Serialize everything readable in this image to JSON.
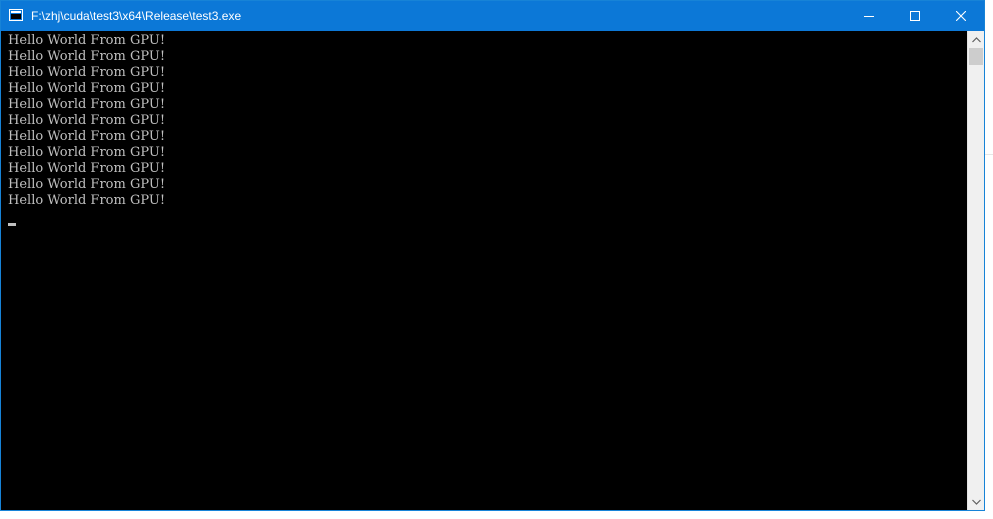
{
  "window": {
    "title": "F:\\zhj\\cuda\\test3\\x64\\Release\\test3.exe",
    "accent_color": "#0c78d7"
  },
  "title_bar": {
    "app_icon": "console-app-icon",
    "buttons": [
      {
        "name": "minimize",
        "icon": "minimize-icon"
      },
      {
        "name": "maximize",
        "icon": "maximize-icon"
      },
      {
        "name": "close",
        "icon": "close-icon"
      }
    ]
  },
  "console": {
    "background": "#000000",
    "text_color": "#c0c0c0",
    "lines": [
      "Hello World From GPU!",
      "Hello World From GPU!",
      "Hello World From GPU!",
      "Hello World From GPU!",
      "Hello World From GPU!",
      "Hello World From GPU!",
      "Hello World From GPU!",
      "Hello World From GPU!",
      "Hello World From GPU!",
      "Hello World From GPU!",
      "Hello World From GPU!"
    ]
  },
  "scrollbar": {
    "up_icon": "chevron-up-icon",
    "down_icon": "chevron-down-icon",
    "position": 0
  }
}
